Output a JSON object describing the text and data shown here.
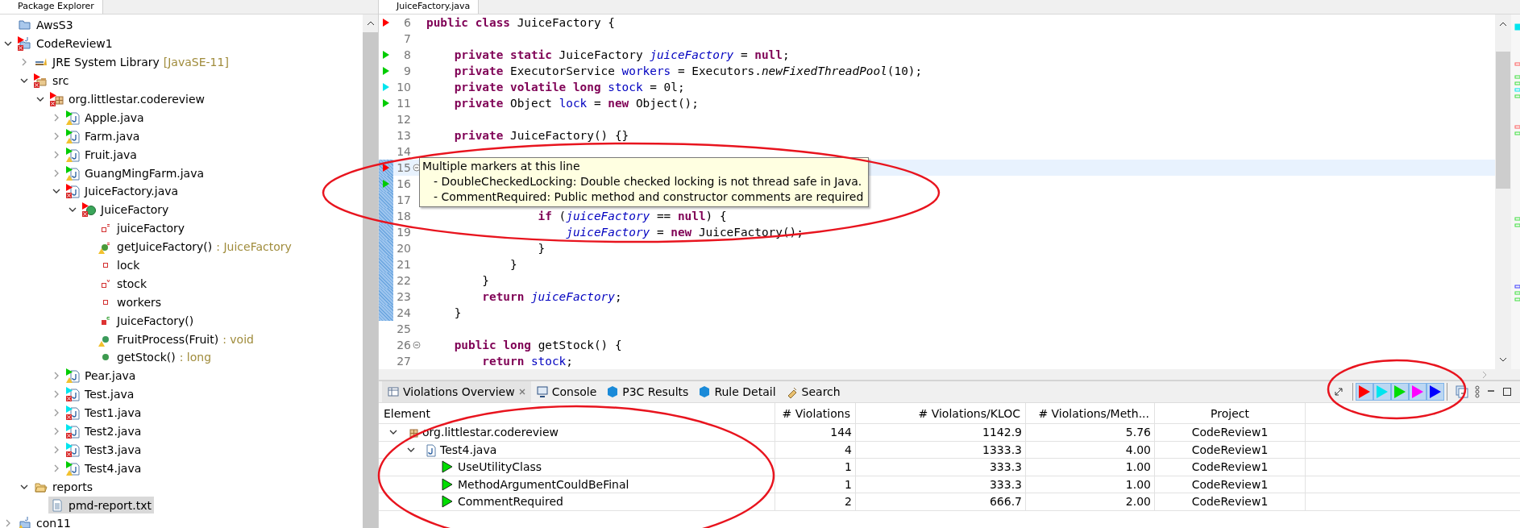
{
  "explorer": {
    "title": "Package Explorer",
    "tree": [
      {
        "label": "AwsS3",
        "kind": "project",
        "selected": false
      },
      {
        "label": "CodeReview1",
        "kind": "java-project",
        "color": "#ff0000",
        "error": true,
        "expanded": true,
        "selected": false,
        "children": [
          {
            "label": "JRE System Library",
            "suffix": "[JavaSE-11]",
            "kind": "library",
            "expanded": false,
            "selected": false
          },
          {
            "label": "src",
            "kind": "source-folder",
            "color": "#ff0000",
            "error": true,
            "expanded": true,
            "selected": false,
            "children": [
              {
                "label": "org.littlestar.codereview",
                "kind": "package",
                "color": "#ff0000",
                "error": true,
                "expanded": true,
                "selected": false,
                "children": [
                  {
                    "label": "Apple.java",
                    "kind": "java-file",
                    "color": "#00cc00",
                    "warning": true,
                    "expanded": false,
                    "selected": false
                  },
                  {
                    "label": "Farm.java",
                    "kind": "java-file",
                    "color": "#00cc00",
                    "warning": true,
                    "expanded": false,
                    "selected": false
                  },
                  {
                    "label": "Fruit.java",
                    "kind": "java-file",
                    "color": "#00cc00",
                    "warning": true,
                    "expanded": false,
                    "selected": false
                  },
                  {
                    "label": "GuangMingFarm.java",
                    "kind": "java-file",
                    "color": "#00cc00",
                    "warning": true,
                    "expanded": false,
                    "selected": false
                  },
                  {
                    "label": "JuiceFactory.java",
                    "kind": "java-file",
                    "color": "#ff0000",
                    "error": true,
                    "expanded": true,
                    "selected": false,
                    "children": [
                      {
                        "label": "JuiceFactory",
                        "kind": "class",
                        "color": "#ff0000",
                        "error": true,
                        "expanded": true,
                        "selected": false,
                        "children": [
                          {
                            "label": "juiceFactory",
                            "kind": "static-field",
                            "selected": false
                          },
                          {
                            "label": "getJuiceFactory()",
                            "suffix": ": JuiceFactory",
                            "kind": "static-method",
                            "warning": true,
                            "selected": false
                          },
                          {
                            "label": "lock",
                            "kind": "private-field",
                            "selected": false
                          },
                          {
                            "label": "stock",
                            "kind": "volatile-field",
                            "selected": false
                          },
                          {
                            "label": "workers",
                            "kind": "private-field",
                            "selected": false
                          },
                          {
                            "label": "JuiceFactory()",
                            "kind": "constructor",
                            "selected": false
                          },
                          {
                            "label": "FruitProcess(Fruit)",
                            "suffix": ": void",
                            "kind": "default-method",
                            "warning": true,
                            "selected": false
                          },
                          {
                            "label": "getStock()",
                            "suffix": ": long",
                            "kind": "public-method",
                            "selected": false
                          }
                        ]
                      }
                    ]
                  },
                  {
                    "label": "Pear.java",
                    "kind": "java-file",
                    "color": "#00cc00",
                    "warning": true,
                    "expanded": false,
                    "selected": false
                  },
                  {
                    "label": "Test.java",
                    "kind": "java-file",
                    "color": "#00e5ee",
                    "error": true,
                    "expanded": false,
                    "selected": false
                  },
                  {
                    "label": "Test1.java",
                    "kind": "java-file",
                    "color": "#00e5ee",
                    "error": true,
                    "expanded": false,
                    "selected": false
                  },
                  {
                    "label": "Test2.java",
                    "kind": "java-file",
                    "color": "#00e5ee",
                    "error": true,
                    "expanded": false,
                    "selected": false
                  },
                  {
                    "label": "Test3.java",
                    "kind": "java-file",
                    "color": "#00e5ee",
                    "error": true,
                    "expanded": false,
                    "selected": false
                  },
                  {
                    "label": "Test4.java",
                    "kind": "java-file",
                    "color": "#00cc00",
                    "warning": true,
                    "expanded": false,
                    "selected": false
                  }
                ]
              }
            ]
          },
          {
            "label": "reports",
            "kind": "folder",
            "expanded": true,
            "selected": false,
            "children": [
              {
                "label": "pmd-report.txt",
                "kind": "text-file",
                "selected": true
              }
            ]
          }
        ]
      },
      {
        "label": "con11",
        "kind": "java-project",
        "warning": true,
        "expanded": false,
        "selected": false
      }
    ]
  },
  "editor": {
    "tab": "JuiceFactory.java",
    "lines": [
      {
        "n": "6",
        "color": "#ff0000",
        "tokens": [
          {
            "t": "public class",
            "kind": "kw"
          },
          {
            "t": " JuiceFactory {",
            "kind": "plain"
          }
        ]
      },
      {
        "n": "7"
      },
      {
        "n": "8",
        "color": "#00cc00",
        "tokens": [
          {
            "t": "    private static",
            "kind": "kw"
          },
          {
            "t": " JuiceFactory ",
            "kind": "plain"
          },
          {
            "t": "juiceFactory",
            "kind": "static-field"
          },
          {
            "t": " = ",
            "kind": "plain"
          },
          {
            "t": "null",
            "kind": "kw"
          },
          {
            "t": ";",
            "kind": "plain"
          }
        ]
      },
      {
        "n": "9",
        "color": "#00cc00",
        "tokens": [
          {
            "t": "    private",
            "kind": "kw"
          },
          {
            "t": " ExecutorService ",
            "kind": "plain"
          },
          {
            "t": "workers",
            "kind": "field"
          },
          {
            "t": " = Executors.",
            "kind": "plain"
          },
          {
            "t": "newFixedThreadPool",
            "kind": "static-method"
          },
          {
            "t": "(10);",
            "kind": "plain"
          }
        ]
      },
      {
        "n": "10",
        "color": "#00e5ee",
        "tokens": [
          {
            "t": "    private volatile long",
            "kind": "kw"
          },
          {
            "t": " stock",
            "kind": "field"
          },
          {
            "t": " = 0l;",
            "kind": "plain"
          }
        ]
      },
      {
        "n": "11",
        "color": "#00cc00",
        "tokens": [
          {
            "t": "    private",
            "kind": "kw"
          },
          {
            "t": " Object ",
            "kind": "plain"
          },
          {
            "t": "lock",
            "kind": "field"
          },
          {
            "t": " = ",
            "kind": "plain"
          },
          {
            "t": "new",
            "kind": "kw"
          },
          {
            "t": " Object();",
            "kind": "plain"
          }
        ]
      },
      {
        "n": "12"
      },
      {
        "n": "13",
        "tokens": [
          {
            "t": "    private",
            "kind": "kw"
          },
          {
            "t": " JuiceFactory() {}",
            "kind": "plain"
          }
        ]
      },
      {
        "n": "14"
      },
      {
        "n": "15",
        "color": "#ff0000",
        "fold": true,
        "current": true,
        "changed": true
      },
      {
        "n": "16",
        "color": "#00cc00",
        "changed": true
      },
      {
        "n": "17",
        "changed": true
      },
      {
        "n": "18",
        "changed": true,
        "tokens": [
          {
            "t": "                if",
            "kind": "kw"
          },
          {
            "t": " (",
            "kind": "plain"
          },
          {
            "t": "juiceFactory",
            "kind": "static-field"
          },
          {
            "t": " == ",
            "kind": "plain"
          },
          {
            "t": "null",
            "kind": "kw"
          },
          {
            "t": ") {",
            "kind": "plain"
          }
        ]
      },
      {
        "n": "19",
        "changed": true,
        "tokens": [
          {
            "t": "                    juiceFactory",
            "kind": "static-field"
          },
          {
            "t": " = ",
            "kind": "plain"
          },
          {
            "t": "new",
            "kind": "kw"
          },
          {
            "t": " JuiceFactory();",
            "kind": "plain"
          }
        ]
      },
      {
        "n": "20",
        "changed": true,
        "tokens": [
          {
            "t": "                }",
            "kind": "plain"
          }
        ]
      },
      {
        "n": "21",
        "changed": true,
        "tokens": [
          {
            "t": "            }",
            "kind": "plain"
          }
        ]
      },
      {
        "n": "22",
        "changed": true,
        "tokens": [
          {
            "t": "        }",
            "kind": "plain"
          }
        ]
      },
      {
        "n": "23",
        "changed": true,
        "tokens": [
          {
            "t": "        return",
            "kind": "kw"
          },
          {
            "t": " juiceFactory",
            "kind": "static-field"
          },
          {
            "t": ";",
            "kind": "plain"
          }
        ]
      },
      {
        "n": "24",
        "changed": true,
        "tokens": [
          {
            "t": "    }",
            "kind": "plain"
          }
        ]
      },
      {
        "n": "25"
      },
      {
        "n": "26",
        "fold": true,
        "tokens": [
          {
            "t": "    public long",
            "kind": "kw"
          },
          {
            "t": " getStock() {",
            "kind": "plain"
          }
        ]
      },
      {
        "n": "27",
        "tokens": [
          {
            "t": "        return",
            "kind": "kw"
          },
          {
            "t": " stock",
            "kind": "field"
          },
          {
            "t": ";",
            "kind": "plain"
          }
        ]
      }
    ],
    "tooltip": {
      "title": "Multiple markers at this line",
      "items": [
        "- DoubleCheckedLocking: Double checked locking is not thread safe in Java.",
        "- CommentRequired: Public method and constructor comments are required"
      ]
    }
  },
  "panel": {
    "tabs": [
      {
        "label": "Violations Overview",
        "kind": "violations",
        "closable": true,
        "selected": true
      },
      {
        "label": "Console",
        "kind": "console",
        "selected": false
      },
      {
        "label": "P3C Results",
        "kind": "p3c",
        "selected": false
      },
      {
        "label": "Rule Detail",
        "kind": "p3c",
        "selected": false
      },
      {
        "label": "Search",
        "kind": "search",
        "selected": false
      }
    ],
    "filters": [
      {
        "color": "#ff0000",
        "selected": true
      },
      {
        "color": "#00e5ee",
        "selected": true
      },
      {
        "color": "#00dd00",
        "selected": true
      },
      {
        "color": "#ff00ff",
        "selected": true
      },
      {
        "color": "#0000ff",
        "selected": true
      }
    ],
    "columns": [
      "Element",
      "# Violations",
      "# Violations/KLOC",
      "# Violations/Meth...",
      "Project"
    ],
    "rows": [
      {
        "element": "org.littlestar.codereview",
        "kind": "package",
        "expanded": true,
        "violations": "144",
        "kloc": "1142.9",
        "per_method": "5.76",
        "project": "CodeReview1",
        "children": [
          {
            "element": "Test4.java",
            "kind": "java-file",
            "expanded": true,
            "violations": "4",
            "kloc": "1333.3",
            "per_method": "4.00",
            "project": "CodeReview1",
            "children": [
              {
                "element": "UseUtilityClass",
                "kind": "rule",
                "violations": "1",
                "kloc": "333.3",
                "per_method": "1.00",
                "project": "CodeReview1"
              },
              {
                "element": "MethodArgumentCouldBeFinal",
                "kind": "rule",
                "violations": "1",
                "kloc": "333.3",
                "per_method": "1.00",
                "project": "CodeReview1"
              },
              {
                "element": "CommentRequired",
                "kind": "rule",
                "violations": "2",
                "kloc": "666.7",
                "per_method": "2.00",
                "project": "CodeReview1"
              }
            ]
          }
        ]
      }
    ]
  }
}
